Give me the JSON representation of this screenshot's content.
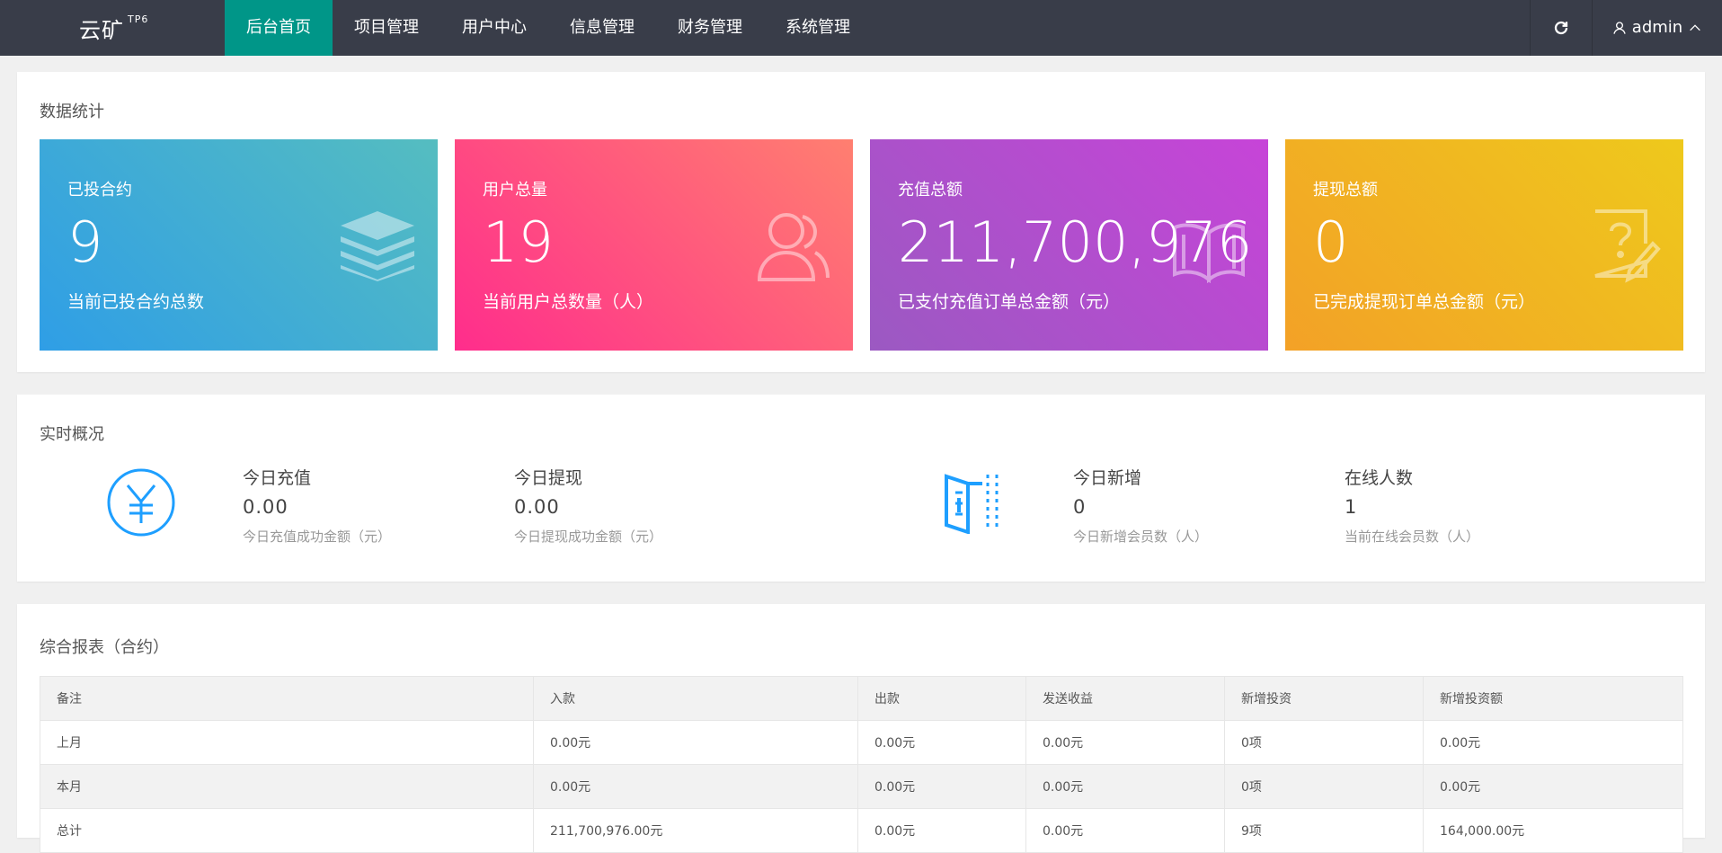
{
  "header": {
    "logo": "云矿",
    "logo_sup": "TP6",
    "nav": [
      "后台首页",
      "项目管理",
      "用户中心",
      "信息管理",
      "财务管理",
      "系统管理"
    ],
    "user": "admin"
  },
  "stats": {
    "title": "数据统计",
    "cards": [
      {
        "label": "已投合约",
        "value": "9",
        "desc": "当前已投合约总数",
        "icon": "layers-icon"
      },
      {
        "label": "用户总量",
        "value": "19",
        "desc": "当前用户总数量（人）",
        "icon": "users-icon"
      },
      {
        "label": "充值总额",
        "value": "211,700,976",
        "desc": "已支付充值订单总金额（元）",
        "icon": "book-icon"
      },
      {
        "label": "提现总额",
        "value": "0",
        "desc": "已完成提现订单总金额（元）",
        "icon": "question-edit-icon"
      }
    ]
  },
  "realtime": {
    "title": "实时概况",
    "items": [
      {
        "label": "今日充值",
        "value": "0.00",
        "desc": "今日充值成功金额（元）"
      },
      {
        "label": "今日提现",
        "value": "0.00",
        "desc": "今日提现成功金额（元）"
      },
      {
        "label": "今日新增",
        "value": "0",
        "desc": "今日新增会员数（人）"
      },
      {
        "label": "在线人数",
        "value": "1",
        "desc": "当前在线会员数（人）"
      }
    ]
  },
  "report": {
    "title": "综合报表（合约）",
    "columns": [
      "备注",
      "入款",
      "出款",
      "发送收益",
      "新增投资",
      "新增投资额"
    ],
    "rows": [
      [
        "上月",
        "0.00元",
        "0.00元",
        "0.00元",
        "0项",
        "0.00元"
      ],
      [
        "本月",
        "0.00元",
        "0.00元",
        "0.00元",
        "0项",
        "0.00元"
      ],
      [
        "总计",
        "211,700,976.00元",
        "0.00元",
        "0.00元",
        "9项",
        "164,000.00元"
      ]
    ]
  },
  "colors": {
    "topbar": "#393d49",
    "active_nav": "#009688",
    "icon_blue": "#1e9fff",
    "card1": [
      "#2f9ee6",
      "#55bdc0"
    ],
    "card2": [
      "#ff3d8b",
      "#ff7a72"
    ],
    "card3": [
      "#9b59c2",
      "#c744d8"
    ],
    "card4": [
      "#f3a127",
      "#eec91c"
    ]
  }
}
